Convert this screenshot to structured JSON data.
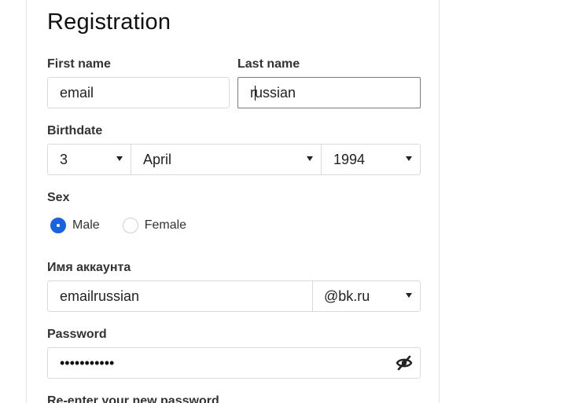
{
  "form": {
    "title": "Registration",
    "first_name": {
      "label": "First name",
      "value": "email"
    },
    "last_name": {
      "label": "Last name",
      "value_before_caret": "r",
      "value_after_caret": "ussian"
    },
    "birthdate": {
      "label": "Birthdate",
      "day": "3",
      "month": "April",
      "year": "1994"
    },
    "sex": {
      "label": "Sex",
      "options": [
        {
          "label": "Male",
          "checked": true
        },
        {
          "label": "Female",
          "checked": false
        }
      ]
    },
    "account": {
      "label": "Имя аккаунта",
      "value": "emailrussian",
      "domain": "@bk.ru"
    },
    "password": {
      "label": "Password",
      "masked_value": "•••••••••••",
      "toggle_icon": "eye-slash-icon"
    },
    "reenter_password": {
      "label": "Re-enter your new password"
    }
  },
  "colors": {
    "accent": "#1a63e0",
    "border": "#dadada",
    "focused_border": "#7a7a7a"
  }
}
